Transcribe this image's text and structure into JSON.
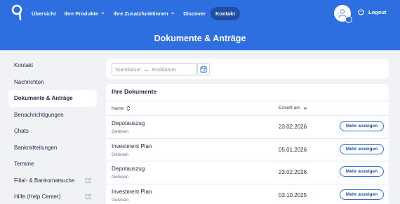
{
  "nav": {
    "items": [
      {
        "label": "Übersicht",
        "dropdown": false,
        "active": false
      },
      {
        "label": "Ihre Produkte",
        "dropdown": true,
        "active": false
      },
      {
        "label": "Ihre Zusatzfunktionen",
        "dropdown": true,
        "active": false
      },
      {
        "label": "Discover",
        "dropdown": false,
        "active": false
      },
      {
        "label": "Kontakt",
        "dropdown": false,
        "active": true
      }
    ],
    "logout_label": "Logout"
  },
  "page": {
    "title": "Dokumente & Anträge"
  },
  "sidebar": {
    "items": [
      {
        "label": "Kontakt",
        "active": false,
        "external": false
      },
      {
        "label": "Nachrichten",
        "active": false,
        "external": false
      },
      {
        "label": "Dokumente & Anträge",
        "active": true,
        "external": false
      },
      {
        "label": "Benachrichtigungen",
        "active": false,
        "external": false
      },
      {
        "label": "Chats",
        "active": false,
        "external": false
      },
      {
        "label": "Bankmitteilungen",
        "active": false,
        "external": false
      },
      {
        "label": "Termine",
        "active": false,
        "external": false
      },
      {
        "label": "Filial- & Bankomatsuche",
        "active": false,
        "external": true
      },
      {
        "label": "Hilfe (Help Center)",
        "active": false,
        "external": true
      }
    ]
  },
  "filter": {
    "start_placeholder": "Startdatum",
    "separator": "–",
    "end_placeholder": "Enddatum"
  },
  "documents": {
    "title": "Ihre Dokumente",
    "columns": {
      "name": "Name",
      "created": "Erstellt am"
    },
    "more_label": "Mehr anzeigen",
    "rows": [
      {
        "title": "Depotauszug",
        "status": "Gelesen",
        "date": "23.02.2026"
      },
      {
        "title": "Investment Plan",
        "status": "Gelesen",
        "date": "05.01.2026"
      },
      {
        "title": "Depotauszug",
        "status": "Gelesen",
        "date": "23.02.2026"
      },
      {
        "title": "Investment Plan",
        "status": "Gelesen",
        "date": "03.10.2025"
      }
    ]
  },
  "colors": {
    "brand_blue": "#2d6fe0",
    "active_nav": "#1f4ea3",
    "background": "#f0f2f6"
  }
}
